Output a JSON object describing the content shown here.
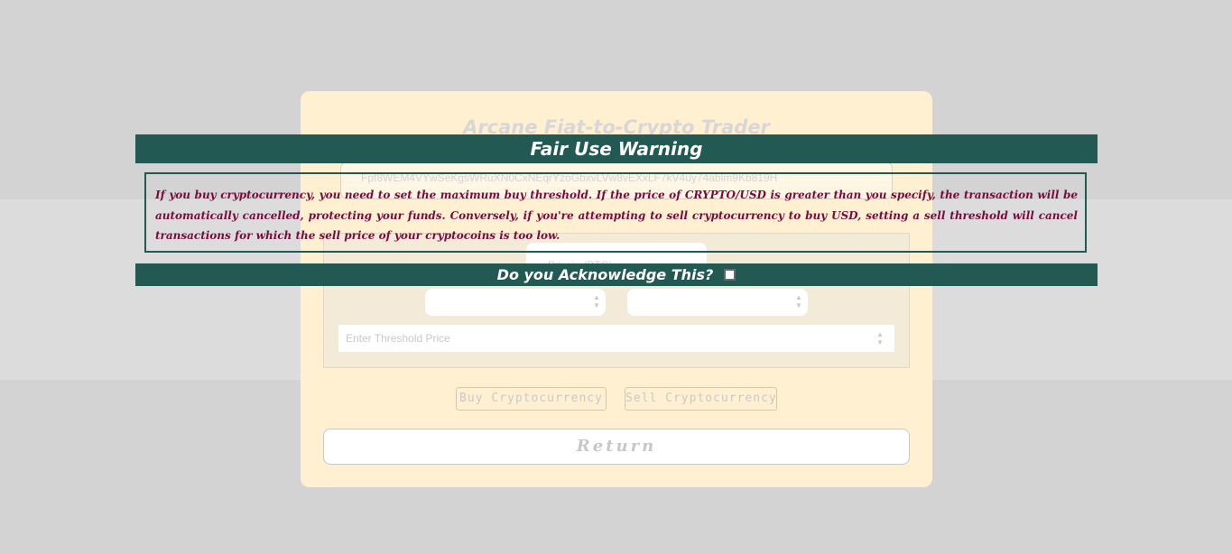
{
  "card": {
    "title": "Arcane Fiat-to-Crypto Trader",
    "wallet_address": "Fpf8WEM4VYwSeKgsWRuXN0CxNEqrYzoGbxvLVw8vEXxLF7kV4uy74ablm9Kb819H",
    "crypto_select": {
      "value": "Bitcoin (BTC)"
    },
    "threshold": {
      "placeholder": "Enter Threshold Price"
    },
    "buy_label": "Buy Cryptocurrency",
    "sell_label": "Sell Cryptocurrency",
    "return_label": "Return"
  },
  "warning": {
    "title": "Fair Use Warning",
    "body": "If you buy cryptocurrency, you need to set the maximum buy threshold. If the price of CRYPTO/USD is greater than you specify, the transaction will be automatically cancelled, protecting your funds. Conversely, if you're attempting to sell cryptocurrency to buy USD, setting a sell threshold will cancel transactions for which the sell price of your cryptocoins is too low.",
    "acknowledge_label": "Do you Acknowledge This?",
    "acknowledged": false
  },
  "colors": {
    "page_background": "#d3d3d3",
    "card_background": "#fff0d2",
    "warning_bar": "#225953",
    "warning_text": "#7a0a3e"
  }
}
